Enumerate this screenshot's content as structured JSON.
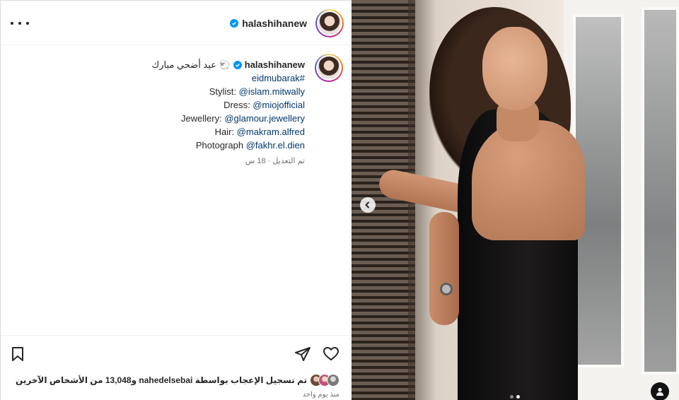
{
  "header": {
    "username": "halashihanew",
    "more_icon": "more-horizontal-icon",
    "verified_icon": "verified-badge-icon"
  },
  "caption": {
    "username": "halashihanew",
    "title_text": "عيد أضحي مبارك 🐑",
    "hashtag": "eidmubarak#",
    "credits": [
      {
        "label": "Stylist: ",
        "handle": "@islam.mitwally"
      },
      {
        "label": "Dress: ",
        "handle": "@miojofficial"
      },
      {
        "label": "Jewellery: ",
        "handle": "@glamour.jewellery"
      },
      {
        "label": "Hair: ",
        "handle": "@makram.alfred"
      },
      {
        "label": "Photograph ",
        "handle": "@fakhr.el.dien"
      }
    ],
    "edited_time": "تم التعديل · 18 س"
  },
  "actions": {
    "bookmark_icon": "bookmark-icon",
    "share_icon": "send-icon",
    "like_icon": "heart-icon",
    "likes_text": "تم تسجيل الإعجاب بواسطة nahedelsebai و13,048 من الأشخاص الآخرين",
    "post_date": "منذ يوم واحد"
  },
  "media": {
    "prev_icon": "chevron-left-icon",
    "tag_icon": "user-tag-icon",
    "carousel_count": 2,
    "carousel_active": 2
  },
  "colors": {
    "link": "#00376b",
    "verified": "#0095f6",
    "text": "#262626",
    "muted": "#737373"
  }
}
